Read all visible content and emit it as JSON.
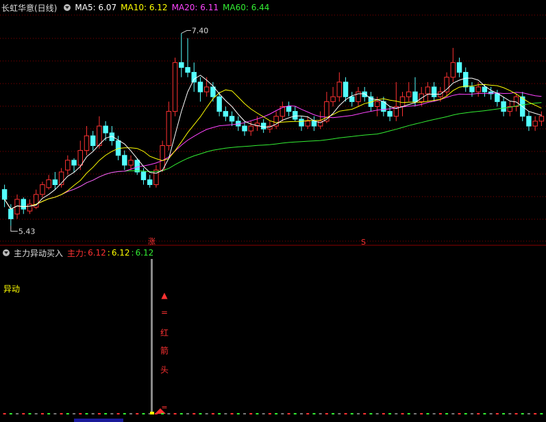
{
  "main_panel": {
    "stock_title": "长虹华意(日线)",
    "ma_labels": [
      {
        "text": "MA5: 6.07",
        "color": "#ffffff"
      },
      {
        "text": "MA10: 6.12",
        "color": "#ffff00"
      },
      {
        "text": "MA20: 6.11",
        "color": "#ff44ff"
      },
      {
        "text": "MA60: 6.44",
        "color": "#33ee33"
      }
    ],
    "high_label": "7.40",
    "low_label": "5.43",
    "marker_zhang": "涨",
    "marker_s": "S"
  },
  "indicator_panel": {
    "title": "主力异动买入",
    "zhuli_label": "主力:",
    "zhuli_values": [
      "6.12",
      "6.12",
      "6.12"
    ],
    "yidong_label": "异动",
    "signal_text": [
      "▲",
      "=",
      "红",
      "箭",
      "头"
    ],
    "bottom_mark": "="
  },
  "colors": {
    "up": "#ff3232",
    "down": "#54ffff",
    "ma5": "#ffffff",
    "ma10": "#ffff00",
    "ma20": "#ff44ff",
    "ma60": "#33ee33",
    "grid": "#8b0000"
  },
  "chart_data": {
    "type": "candlestick",
    "y_range": [
      5.3,
      7.6
    ],
    "candles": [
      [
        5.8,
        5.7,
        5.85,
        5.62
      ],
      [
        5.6,
        5.5,
        5.65,
        5.43
      ],
      [
        5.55,
        5.7,
        5.75,
        5.5
      ],
      [
        5.7,
        5.6,
        5.72,
        5.55
      ],
      [
        5.58,
        5.65,
        5.7,
        5.55
      ],
      [
        5.62,
        5.75,
        5.8,
        5.6
      ],
      [
        5.75,
        5.85,
        5.88,
        5.72
      ],
      [
        5.82,
        5.9,
        5.95,
        5.8
      ],
      [
        5.9,
        5.85,
        5.98,
        5.8
      ],
      [
        5.85,
        5.98,
        6.02,
        5.82
      ],
      [
        6.0,
        6.1,
        6.15,
        5.95
      ],
      [
        6.1,
        6.05,
        6.12,
        5.98
      ],
      [
        6.05,
        6.2,
        6.3,
        6.0
      ],
      [
        6.2,
        6.35,
        6.45,
        6.15
      ],
      [
        6.35,
        6.25,
        6.4,
        6.2
      ],
      [
        6.25,
        6.45,
        6.55,
        6.22
      ],
      [
        6.45,
        6.38,
        6.5,
        6.3
      ],
      [
        6.38,
        6.3,
        6.45,
        6.25
      ],
      [
        6.3,
        6.15,
        6.35,
        6.1
      ],
      [
        6.15,
        6.05,
        6.2,
        6.0
      ],
      [
        6.05,
        6.1,
        6.15,
        6.0
      ],
      [
        6.1,
        5.98,
        6.12,
        5.95
      ],
      [
        5.98,
        5.9,
        6.02,
        5.85
      ],
      [
        5.9,
        5.85,
        5.95,
        5.82
      ],
      [
        5.85,
        6.0,
        6.05,
        5.82
      ],
      [
        6.0,
        6.25,
        6.3,
        5.98
      ],
      [
        6.25,
        6.6,
        6.7,
        6.2
      ],
      [
        6.6,
        7.1,
        7.15,
        6.55
      ],
      [
        7.1,
        7.05,
        7.4,
        6.95
      ],
      [
        7.05,
        7.0,
        7.35,
        6.95
      ],
      [
        7.0,
        6.9,
        7.1,
        6.8
      ],
      [
        6.9,
        6.8,
        6.95,
        6.7
      ],
      [
        6.8,
        6.85,
        6.95,
        6.75
      ],
      [
        6.85,
        6.75,
        6.9,
        6.7
      ],
      [
        6.75,
        6.6,
        6.8,
        6.55
      ],
      [
        6.6,
        6.55,
        6.65,
        6.5
      ],
      [
        6.55,
        6.5,
        6.6,
        6.45
      ],
      [
        6.5,
        6.45,
        6.55,
        6.4
      ],
      [
        6.45,
        6.4,
        6.5,
        6.35
      ],
      [
        6.4,
        6.45,
        6.5,
        6.35
      ],
      [
        6.45,
        6.48,
        6.55,
        6.4
      ],
      [
        6.48,
        6.42,
        6.52,
        6.38
      ],
      [
        6.42,
        6.45,
        6.5,
        6.38
      ],
      [
        6.45,
        6.55,
        6.6,
        6.42
      ],
      [
        6.55,
        6.65,
        6.7,
        6.5
      ],
      [
        6.65,
        6.6,
        6.7,
        6.55
      ],
      [
        6.6,
        6.52,
        6.65,
        6.5
      ],
      [
        6.52,
        6.45,
        6.55,
        6.4
      ],
      [
        6.45,
        6.5,
        6.55,
        6.42
      ],
      [
        6.5,
        6.45,
        6.55,
        6.4
      ],
      [
        6.45,
        6.5,
        6.6,
        6.42
      ],
      [
        6.5,
        6.7,
        6.8,
        6.48
      ],
      [
        6.7,
        6.75,
        6.85,
        6.65
      ],
      [
        6.75,
        6.9,
        7.0,
        6.7
      ],
      [
        6.9,
        6.75,
        6.95,
        6.7
      ],
      [
        6.75,
        6.7,
        6.8,
        6.65
      ],
      [
        6.7,
        6.8,
        6.85,
        6.65
      ],
      [
        6.8,
        6.75,
        6.85,
        6.7
      ],
      [
        6.75,
        6.65,
        6.8,
        6.6
      ],
      [
        6.65,
        6.7,
        6.75,
        6.55
      ],
      [
        6.7,
        6.6,
        6.75,
        6.55
      ],
      [
        6.6,
        6.55,
        6.65,
        6.5
      ],
      [
        6.55,
        6.65,
        6.9,
        6.5
      ],
      [
        6.65,
        6.75,
        6.8,
        6.55
      ],
      [
        6.75,
        6.8,
        6.9,
        6.7
      ],
      [
        6.8,
        6.7,
        6.95,
        6.65
      ],
      [
        6.7,
        6.78,
        6.85,
        6.65
      ],
      [
        6.78,
        6.85,
        6.9,
        6.7
      ],
      [
        6.85,
        6.75,
        6.9,
        6.7
      ],
      [
        6.75,
        6.8,
        6.85,
        6.7
      ],
      [
        6.8,
        6.95,
        7.0,
        6.75
      ],
      [
        6.95,
        7.1,
        7.25,
        6.9
      ],
      [
        7.1,
        7.0,
        7.15,
        6.95
      ],
      [
        7.0,
        6.85,
        7.05,
        6.8
      ],
      [
        6.85,
        6.8,
        6.9,
        6.75
      ],
      [
        6.8,
        6.85,
        6.9,
        6.75
      ],
      [
        6.85,
        6.8,
        6.88,
        6.75
      ],
      [
        6.8,
        6.78,
        6.85,
        6.72
      ],
      [
        6.78,
        6.7,
        6.82,
        6.65
      ],
      [
        6.7,
        6.6,
        6.75,
        6.55
      ],
      [
        6.6,
        6.65,
        6.7,
        6.55
      ],
      [
        6.65,
        6.75,
        6.78,
        6.6
      ],
      [
        6.75,
        6.55,
        6.8,
        6.5
      ],
      [
        6.55,
        6.45,
        6.6,
        6.4
      ],
      [
        6.45,
        6.5,
        6.55,
        6.4
      ],
      [
        6.5,
        6.55,
        6.6,
        6.45
      ]
    ]
  }
}
